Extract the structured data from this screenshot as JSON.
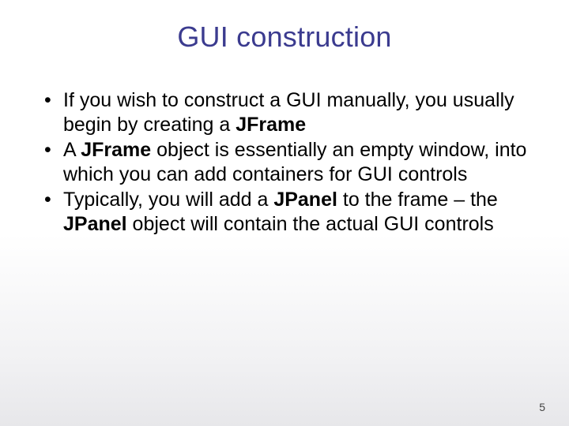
{
  "title": "GUI construction",
  "bullets": [
    {
      "pre": "If you wish to construct a GUI manually, you usually begin by creating a ",
      "b1": "JFrame",
      "mid": "",
      "b2": "",
      "post": ""
    },
    {
      "pre": "A ",
      "b1": "JFrame",
      "mid": " object is essentially an empty window, into which you can add containers for GUI controls",
      "b2": "",
      "post": ""
    },
    {
      "pre": "Typically, you will add a ",
      "b1": "JPanel",
      "mid": " to the frame – the ",
      "b2": "JPanel",
      "post": " object will contain the actual GUI controls"
    }
  ],
  "pageNumber": "5"
}
